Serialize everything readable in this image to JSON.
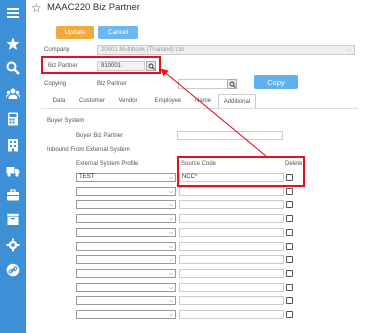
{
  "header": {
    "title": "MAAC220 Biz Partner"
  },
  "toolbar": {
    "update_label": "Update",
    "cancel_label": "Cancel"
  },
  "form": {
    "company_label": "Company",
    "company_value": "20001 Multibook (Thailand) Ltd",
    "biz_partner_label": "Biz Partner",
    "biz_partner_value": "910001",
    "copying_label": "Copying",
    "copying_biz_partner_label": "Biz Partner",
    "copy_label": "Copy"
  },
  "tabs": [
    "Data",
    "Customer",
    "Vendor",
    "Employee",
    "Name",
    "Additional"
  ],
  "active_tab": "Additional",
  "sections": {
    "buyer_system": "Buyer System",
    "buyer_biz_partner": "Buyer Biz Partner",
    "inbound_from_external": "Inbound From External System",
    "external_system_profile": "External System Profile",
    "source_code": "Source Code",
    "delete": "Delete"
  },
  "rows": [
    {
      "profile": "TEST",
      "source_code": "NCC*"
    },
    {
      "profile": "",
      "source_code": ""
    },
    {
      "profile": "",
      "source_code": ""
    },
    {
      "profile": "",
      "source_code": ""
    },
    {
      "profile": "",
      "source_code": ""
    },
    {
      "profile": "",
      "source_code": ""
    },
    {
      "profile": "",
      "source_code": ""
    },
    {
      "profile": "",
      "source_code": ""
    },
    {
      "profile": "",
      "source_code": ""
    },
    {
      "profile": "",
      "source_code": ""
    },
    {
      "profile": "",
      "source_code": ""
    }
  ],
  "colors": {
    "sidebar": "#3d8fd6",
    "update": "#f0a93c",
    "cancel": "#6cb7f0",
    "highlight": "#e0141e"
  }
}
